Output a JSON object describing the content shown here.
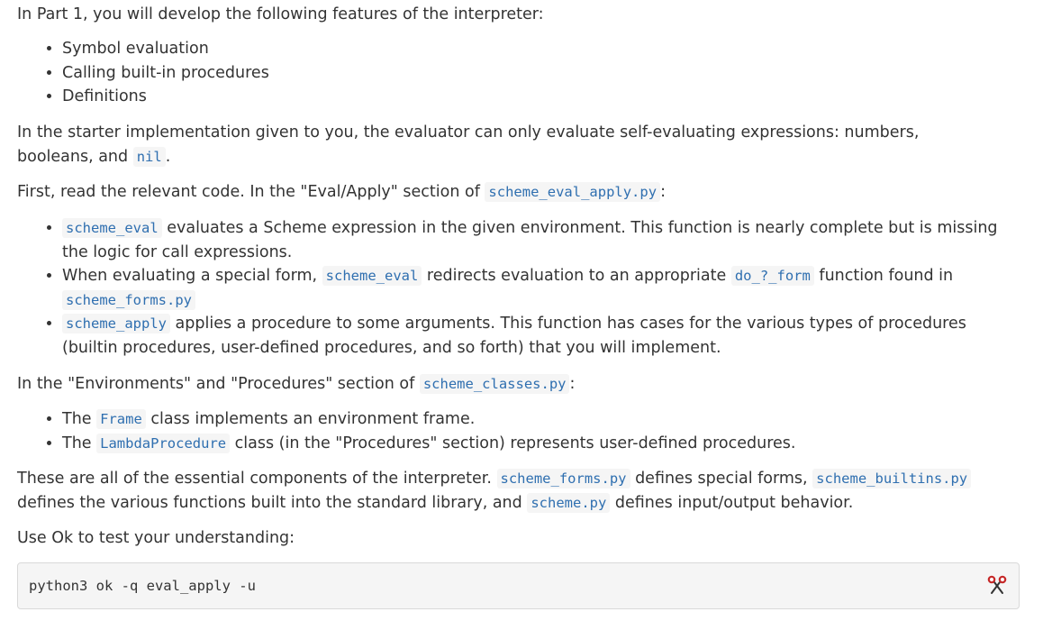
{
  "intro": "In Part 1, you will develop the following features of the interpreter:",
  "features": [
    "Symbol evaluation",
    "Calling built-in procedures",
    "Definitions"
  ],
  "starter": {
    "text_before": "In the starter implementation given to you, the evaluator can only evaluate self-evaluating expressions: numbers, booleans, and ",
    "code": "nil",
    "text_after": "."
  },
  "read_code": {
    "text_before": "First, read the relevant code. In the \"Eval/Apply\" section of ",
    "code": "scheme_eval_apply.py",
    "text_after": ":"
  },
  "eval_apply_items": [
    {
      "code": "scheme_eval",
      "text": " evaluates a Scheme expression in the given environment. This function is nearly complete but is missing the logic for call expressions."
    },
    {
      "text_before": "When evaluating a special form, ",
      "code1": "scheme_eval",
      "text_middle": " redirects evaluation to an appropriate ",
      "code2": "do_?_form",
      "text_after": " function found in ",
      "code3": "scheme_forms.py"
    },
    {
      "code": "scheme_apply",
      "text": " applies a procedure to some arguments. This function has cases for the various types of procedures (builtin procedures, user-defined procedures, and so forth) that you will implement."
    }
  ],
  "env_section": {
    "text_before": "In the \"Environments\" and \"Procedures\" section of ",
    "code": "scheme_classes.py",
    "text_after": ":"
  },
  "class_items": [
    {
      "text_before": "The ",
      "code": "Frame",
      "text_after": " class implements an environment frame."
    },
    {
      "text_before": "The ",
      "code": "LambdaProcedure",
      "text_after": " class (in the \"Procedures\" section) represents user-defined procedures."
    }
  ],
  "components": {
    "text1": "These are all of the essential components of the interpreter. ",
    "code1": "scheme_forms.py",
    "text2": " defines special forms, ",
    "code2": "scheme_builtins.py",
    "text3": " defines the various functions built into the standard library, and ",
    "code3": "scheme.py",
    "text4": " defines input/output behavior."
  },
  "ok_prompt": "Use Ok to test your understanding:",
  "command": "python3 ok -q eval_apply -u",
  "copy_icon": "scissors-icon",
  "colors": {
    "code_text": "#2f6fb0",
    "code_bg": "#f5f5f5",
    "body_text": "#333333"
  }
}
